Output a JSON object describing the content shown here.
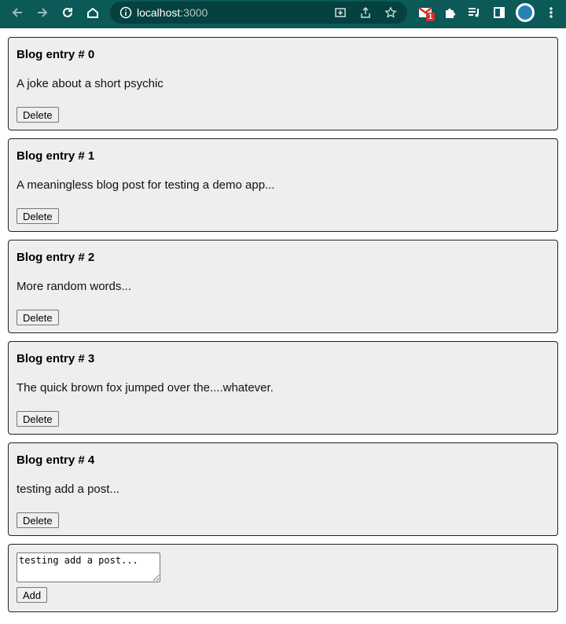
{
  "browser": {
    "url_host": "localhost",
    "url_port": ":3000",
    "extension_badge_count": "1"
  },
  "posts": [
    {
      "title": "Blog entry # 0",
      "body": "A joke about a short psychic",
      "delete_label": "Delete"
    },
    {
      "title": "Blog entry # 1",
      "body": "A meaningless blog post for testing a demo app...",
      "delete_label": "Delete"
    },
    {
      "title": "Blog entry # 2",
      "body": "More random words...",
      "delete_label": "Delete"
    },
    {
      "title": "Blog entry # 3",
      "body": "The quick brown fox jumped over the....whatever.",
      "delete_label": "Delete"
    },
    {
      "title": "Blog entry # 4",
      "body": "testing add a post...",
      "delete_label": "Delete"
    }
  ],
  "new_post": {
    "value": "testing add a post...",
    "add_label": "Add"
  }
}
